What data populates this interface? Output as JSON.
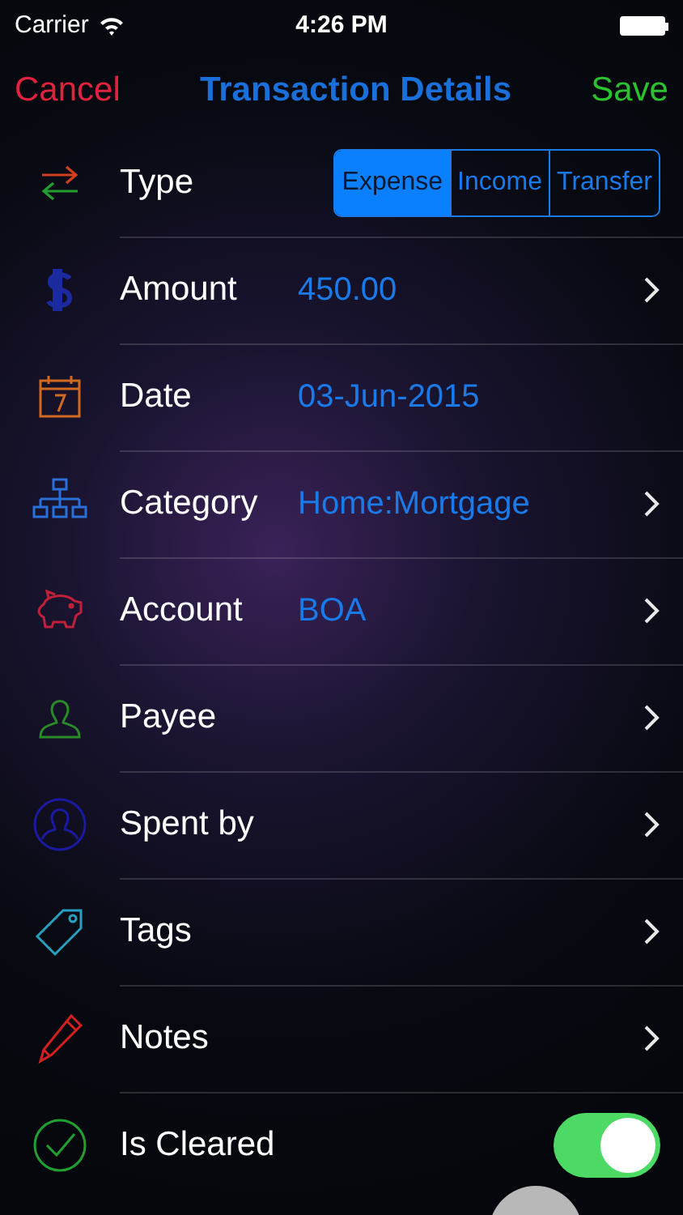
{
  "status_bar": {
    "carrier": "Carrier",
    "time": "4:26 PM"
  },
  "nav": {
    "cancel": "Cancel",
    "title": "Transaction Details",
    "save": "Save"
  },
  "rows": [
    {
      "kind": "segmented",
      "label": "Type",
      "segments": [
        {
          "label": "Expense",
          "selected": true
        },
        {
          "label": "Income",
          "selected": false
        },
        {
          "label": "Transfer",
          "selected": false
        }
      ]
    },
    {
      "kind": "disclosure",
      "label": "Amount",
      "value": "450.00"
    },
    {
      "kind": "plain",
      "label": "Date",
      "value": "03-Jun-2015"
    },
    {
      "kind": "disclosure",
      "label": "Category",
      "value": "Home:Mortgage"
    },
    {
      "kind": "disclosure",
      "label": "Account",
      "value": "BOA"
    },
    {
      "kind": "disclosure",
      "label": "Payee"
    },
    {
      "kind": "disclosure",
      "label": "Spent by"
    },
    {
      "kind": "disclosure",
      "label": "Tags"
    },
    {
      "kind": "disclosure",
      "label": "Notes"
    },
    {
      "kind": "toggle",
      "label": "Is Cleared",
      "on": true
    }
  ]
}
